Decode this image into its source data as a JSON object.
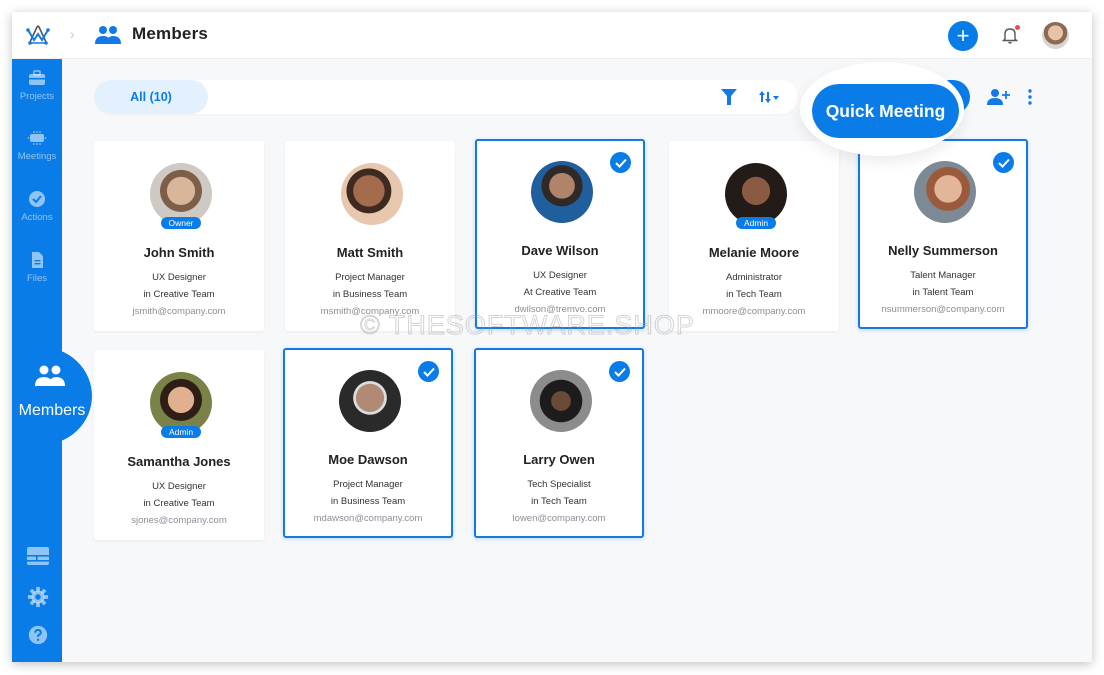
{
  "header": {
    "app_logo": "app-logo",
    "breadcrumb_separator": "›",
    "title": "Members",
    "add_label": "+",
    "has_notification": true
  },
  "sidebar": {
    "items": [
      {
        "label": "Projects",
        "icon": "briefcase-icon"
      },
      {
        "label": "Meetings",
        "icon": "meetings-icon"
      },
      {
        "label": "Actions",
        "icon": "check-circle-icon"
      },
      {
        "label": "Files",
        "icon": "file-icon"
      },
      {
        "label": "Members",
        "icon": "members-icon",
        "active": true
      }
    ],
    "bottom": [
      {
        "icon": "dashboard-icon"
      },
      {
        "icon": "settings-icon"
      },
      {
        "icon": "help-icon"
      }
    ]
  },
  "toolbar": {
    "tab_all": "All (10)",
    "quick_meeting": "Quick Meeting"
  },
  "members": [
    {
      "name": "John Smith",
      "role": "UX Designer",
      "team": "in Creative Team",
      "email": "jsmith@company.com",
      "badge": "Owner",
      "selected": false
    },
    {
      "name": "Matt Smith",
      "role": "Project Manager",
      "team": "in Business Team",
      "email": "msmith@company.com",
      "badge": null,
      "selected": false
    },
    {
      "name": "Dave Wilson",
      "role": "UX Designer",
      "team": "At Creative Team",
      "email": "dwilson@tremvo.com",
      "badge": null,
      "selected": true
    },
    {
      "name": "Melanie Moore",
      "role": "Administrator",
      "team": "in Tech Team",
      "email": "mmoore@company.com",
      "badge": "Admin",
      "selected": false
    },
    {
      "name": "Nelly Summerson",
      "role": "Talent Manager",
      "team": "in Talent Team",
      "email": "nsummerson@company.com",
      "badge": null,
      "selected": true
    },
    {
      "name": "Samantha Jones",
      "role": "UX Designer",
      "team": "in Creative Team",
      "email": "sjones@company.com",
      "badge": "Admin",
      "selected": false
    },
    {
      "name": "Moe Dawson",
      "role": "Project Manager",
      "team": "in Business Team",
      "email": "mdawson@company.com",
      "badge": null,
      "selected": true
    },
    {
      "name": "Larry Owen",
      "role": "Tech Specialist",
      "team": "in Tech Team",
      "email": "lowen@company.com",
      "badge": null,
      "selected": true
    }
  ],
  "colors": {
    "accent": "#0a7ce8",
    "background": "#f7f8fa",
    "notification_dot": "#f04b4b"
  },
  "watermark": "© THESOFTWARE.SHOP"
}
